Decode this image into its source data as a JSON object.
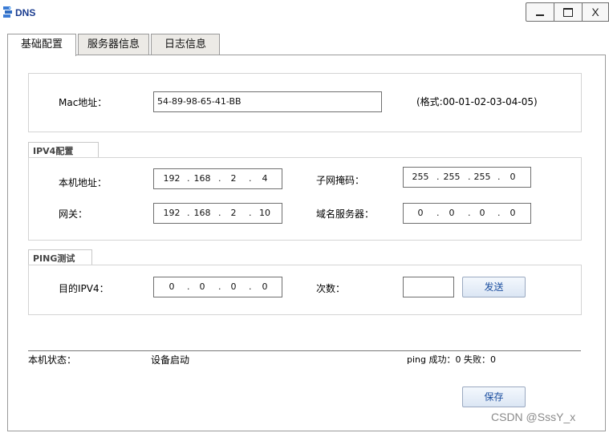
{
  "window": {
    "title": "DNS",
    "buttons": {
      "minimize": "—",
      "maximize": "☐",
      "close": "X"
    }
  },
  "tabs": [
    {
      "label": "基础配置",
      "active": true
    },
    {
      "label": "服务器信息",
      "active": false
    },
    {
      "label": "日志信息",
      "active": false
    }
  ],
  "mac": {
    "label": "Mac地址：",
    "value": "54-89-98-65-41-BB",
    "format_hint": "(格式:00-01-02-03-04-05)"
  },
  "ipv4": {
    "group_title": "IPV4配置",
    "local_address": {
      "label": "本机地址：",
      "octets": [
        "192",
        "168",
        "2",
        "4"
      ]
    },
    "subnet_mask": {
      "label": "子网掩码：",
      "octets": [
        "255",
        "255",
        "255",
        "0"
      ]
    },
    "gateway": {
      "label": "网关：",
      "octets": [
        "192",
        "168",
        "2",
        "10"
      ]
    },
    "dns_server": {
      "label": "域名服务器：",
      "octets": [
        "0",
        "0",
        "0",
        "0"
      ]
    }
  },
  "ping": {
    "group_title": "PING测试",
    "target": {
      "label": "目的IPV4：",
      "octets": [
        "0",
        "0",
        "0",
        "0"
      ]
    },
    "count": {
      "label": "次数：",
      "value": ""
    },
    "send_label": "发送"
  },
  "status": {
    "label": "本机状态：",
    "value": "设备启动",
    "ping_result": "ping 成功：0 失败：0"
  },
  "save_label": "保存",
  "watermark": "CSDN @SssY_x"
}
